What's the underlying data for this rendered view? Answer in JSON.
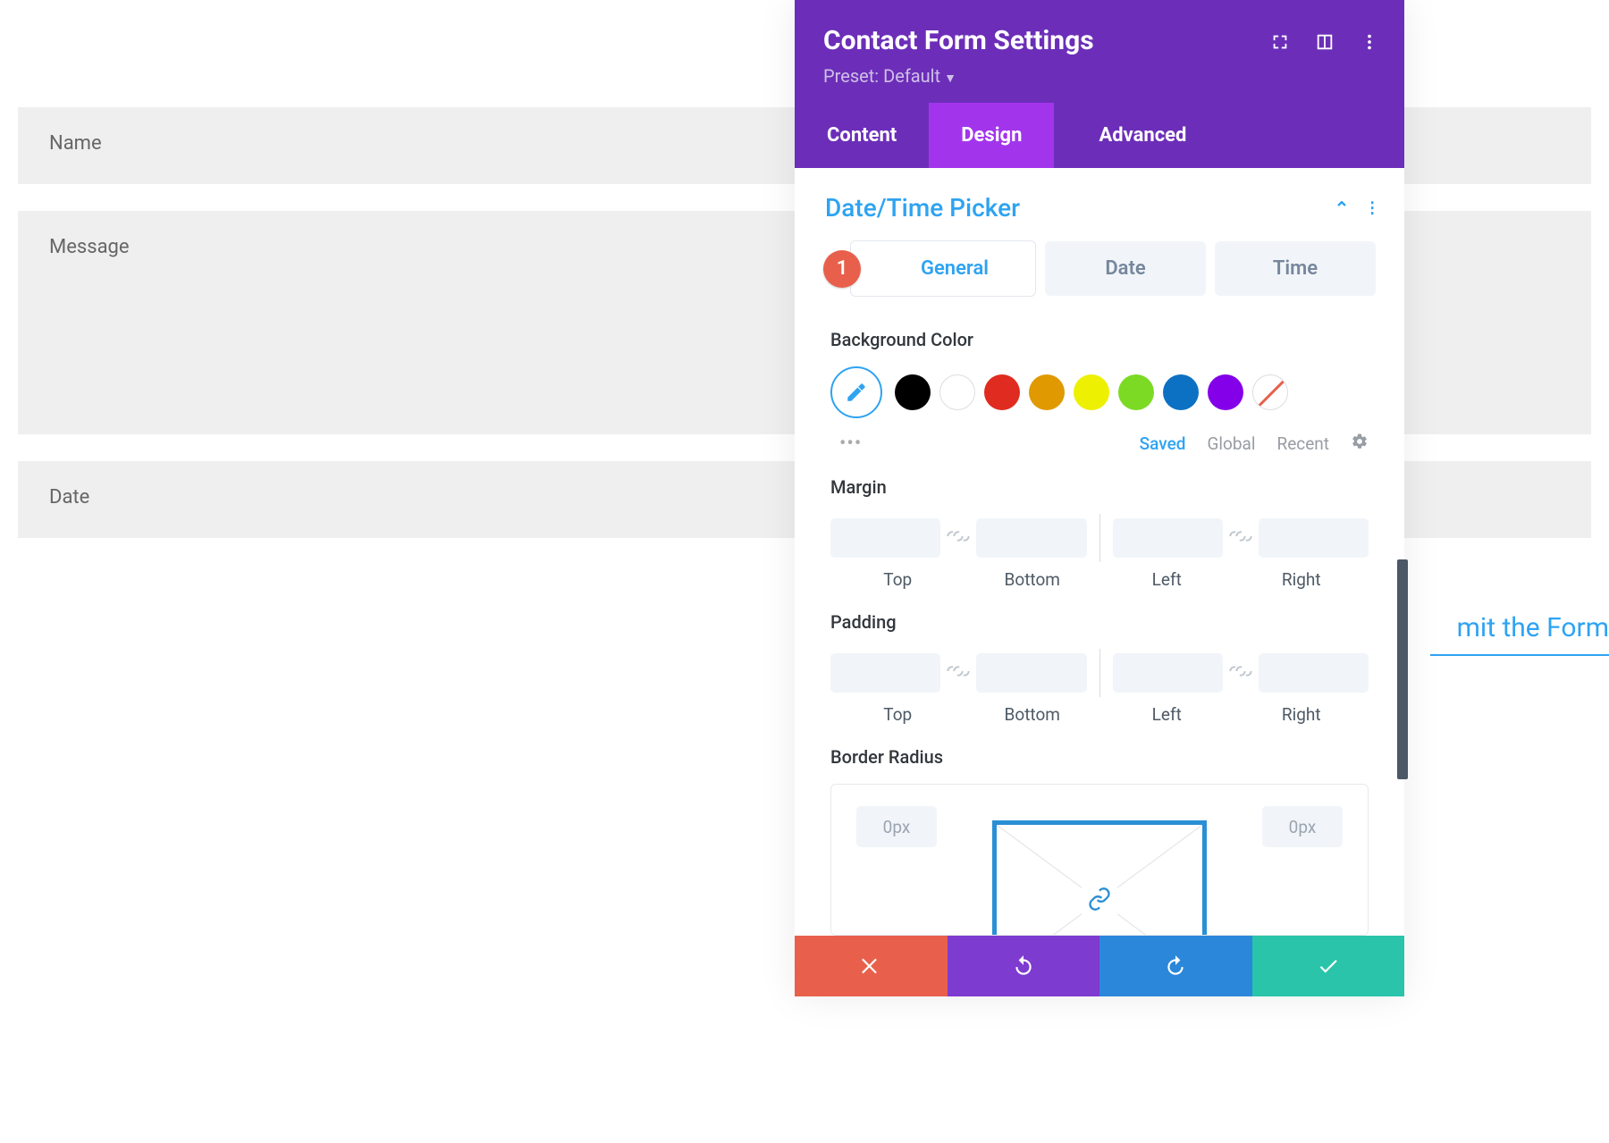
{
  "form": {
    "fields": {
      "name": "Name",
      "message": "Message",
      "date": "Date"
    },
    "submit": "mit the Form"
  },
  "modal": {
    "title": "Contact Form Settings",
    "preset_label": "Preset: Default",
    "tabs": {
      "content": "Content",
      "design": "Design",
      "advanced": "Advanced"
    },
    "section": {
      "title": "Date/Time Picker"
    },
    "badge": "1",
    "subtabs": {
      "general": "General",
      "date": "Date",
      "time": "Time"
    },
    "groups": {
      "bg": "Background Color",
      "margin": "Margin",
      "padding": "Padding",
      "border_radius": "Border Radius"
    },
    "colors": {
      "palette": [
        "#000000",
        "#ffffff",
        "#e02b20",
        "#e09900",
        "#edf000",
        "#7cda24",
        "#0c71c3",
        "#8300e9"
      ]
    },
    "swatch_tabs": {
      "saved": "Saved",
      "global": "Global",
      "recent": "Recent"
    },
    "spacing_labels": {
      "top": "Top",
      "bottom": "Bottom",
      "left": "Left",
      "right": "Right"
    },
    "border": {
      "tl": "0px",
      "tr": "0px"
    }
  }
}
